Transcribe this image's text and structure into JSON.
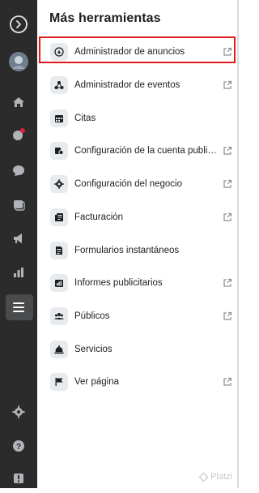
{
  "panel": {
    "title": "Más herramientas"
  },
  "sidebar": {
    "items": [
      {
        "icon": "meta-logo-icon",
        "active": false
      },
      {
        "icon": "profile-avatar",
        "active": false
      },
      {
        "icon": "home-icon",
        "active": false
      },
      {
        "icon": "notifications-icon",
        "active": false
      },
      {
        "icon": "messages-icon",
        "active": false
      },
      {
        "icon": "content-icon",
        "active": false
      },
      {
        "icon": "ads-megaphone-icon",
        "active": false
      },
      {
        "icon": "insights-chart-icon",
        "active": false
      },
      {
        "icon": "menu-icon",
        "active": true
      },
      {
        "icon": "settings-icon",
        "active": false
      },
      {
        "icon": "help-icon",
        "active": false
      },
      {
        "icon": "report-icon",
        "active": false
      }
    ]
  },
  "tools": [
    {
      "label": "Administrador de anuncios",
      "icon": "ads-manager-icon",
      "external": true,
      "highlighted": true
    },
    {
      "label": "Administrador de eventos",
      "icon": "events-manager-icon",
      "external": true
    },
    {
      "label": "Citas",
      "icon": "calendar-icon",
      "external": false
    },
    {
      "label": "Configuración de la cuenta publicitaria",
      "icon": "ad-account-settings-icon",
      "external": true
    },
    {
      "label": "Configuración del negocio",
      "icon": "gear-icon",
      "external": true
    },
    {
      "label": "Facturación",
      "icon": "billing-icon",
      "external": true
    },
    {
      "label": "Formularios instantáneos",
      "icon": "forms-icon",
      "external": false
    },
    {
      "label": "Informes publicitarios",
      "icon": "reports-icon",
      "external": true
    },
    {
      "label": "Públicos",
      "icon": "audiences-icon",
      "external": true
    },
    {
      "label": "Servicios",
      "icon": "service-bell-icon",
      "external": false
    },
    {
      "label": "Ver página",
      "icon": "flag-icon",
      "external": true
    }
  ],
  "watermark": "Platzi",
  "colors": {
    "sidebar": "#2b2b2b",
    "highlight_border": "#e21a1a",
    "icon_bg": "#e8ebee"
  }
}
